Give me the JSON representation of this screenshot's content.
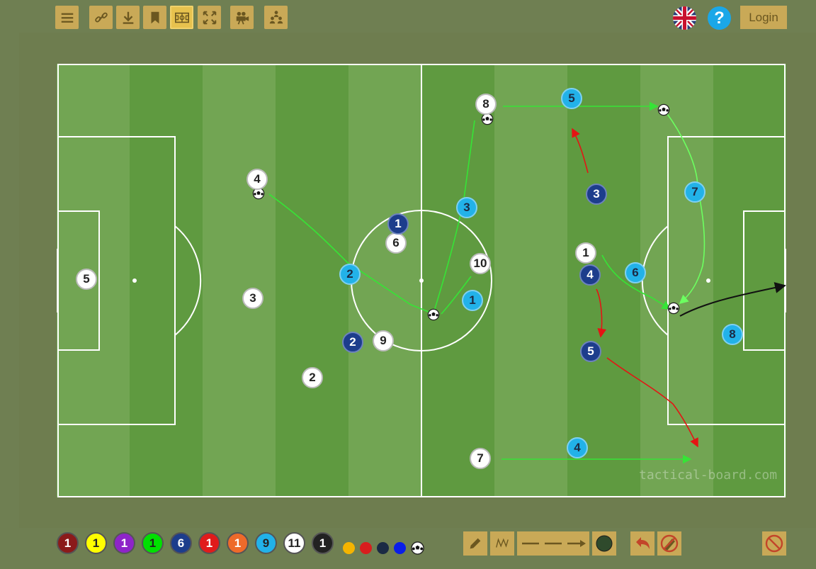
{
  "header": {
    "login_label": "Login",
    "help_label": "?",
    "toolbar_icons": [
      "menu-icon",
      "link-icon",
      "download-icon",
      "bookmark-icon",
      "field-icon",
      "fullscreen-icon",
      "video-icon",
      "formation-icon"
    ],
    "active_tool": "field-icon",
    "language": "uk-flag-icon"
  },
  "board": {
    "watermark": "tactical-board.com",
    "colors": {
      "pitch_light": "#72a553",
      "pitch_dark": "#5f9a40",
      "lines": "#ffffff",
      "frame": "#6e7d4f",
      "accent": "#c9a957",
      "active": "#e7c24e"
    }
  },
  "players": {
    "white": [
      "5",
      "4",
      "3",
      "2",
      "6",
      "9",
      "10",
      "8",
      "7",
      "1"
    ],
    "navy": [
      "1",
      "2",
      "3",
      "4",
      "5"
    ],
    "sky": [
      "2",
      "3",
      "1",
      "5",
      "7",
      "6",
      "8",
      "4"
    ]
  },
  "palette": {
    "tokens": [
      {
        "label": "1",
        "bg": "#8b1a1a",
        "fg": "#ffffff"
      },
      {
        "label": "1",
        "bg": "#ffff00",
        "fg": "#222222"
      },
      {
        "label": "1",
        "bg": "#8e24c8",
        "fg": "#ffffff"
      },
      {
        "label": "1",
        "bg": "#00e000",
        "fg": "#222222"
      },
      {
        "label": "6",
        "bg": "#1d3d8c",
        "fg": "#ffffff"
      },
      {
        "label": "1",
        "bg": "#e01b1b",
        "fg": "#ffffff"
      },
      {
        "label": "1",
        "bg": "#ee6a2a",
        "fg": "#ffffff"
      },
      {
        "label": "9",
        "bg": "#22b2e9",
        "fg": "#222222"
      },
      {
        "label": "11",
        "bg": "#ffffff",
        "fg": "#222222"
      },
      {
        "label": "1",
        "bg": "#222222",
        "fg": "#ffffff"
      }
    ],
    "dots": [
      "#f5b400",
      "#d81e1e",
      "#1b2a44",
      "#0a1ee8"
    ],
    "ball_icon": "ball-icon"
  },
  "tools": [
    "pencil-icon",
    "wave-line-icon",
    "line-icon",
    "dash-line-icon",
    "arrow-line-icon",
    "fill-circle-icon",
    "undo-icon",
    "erase-icon",
    "clear-icon"
  ]
}
